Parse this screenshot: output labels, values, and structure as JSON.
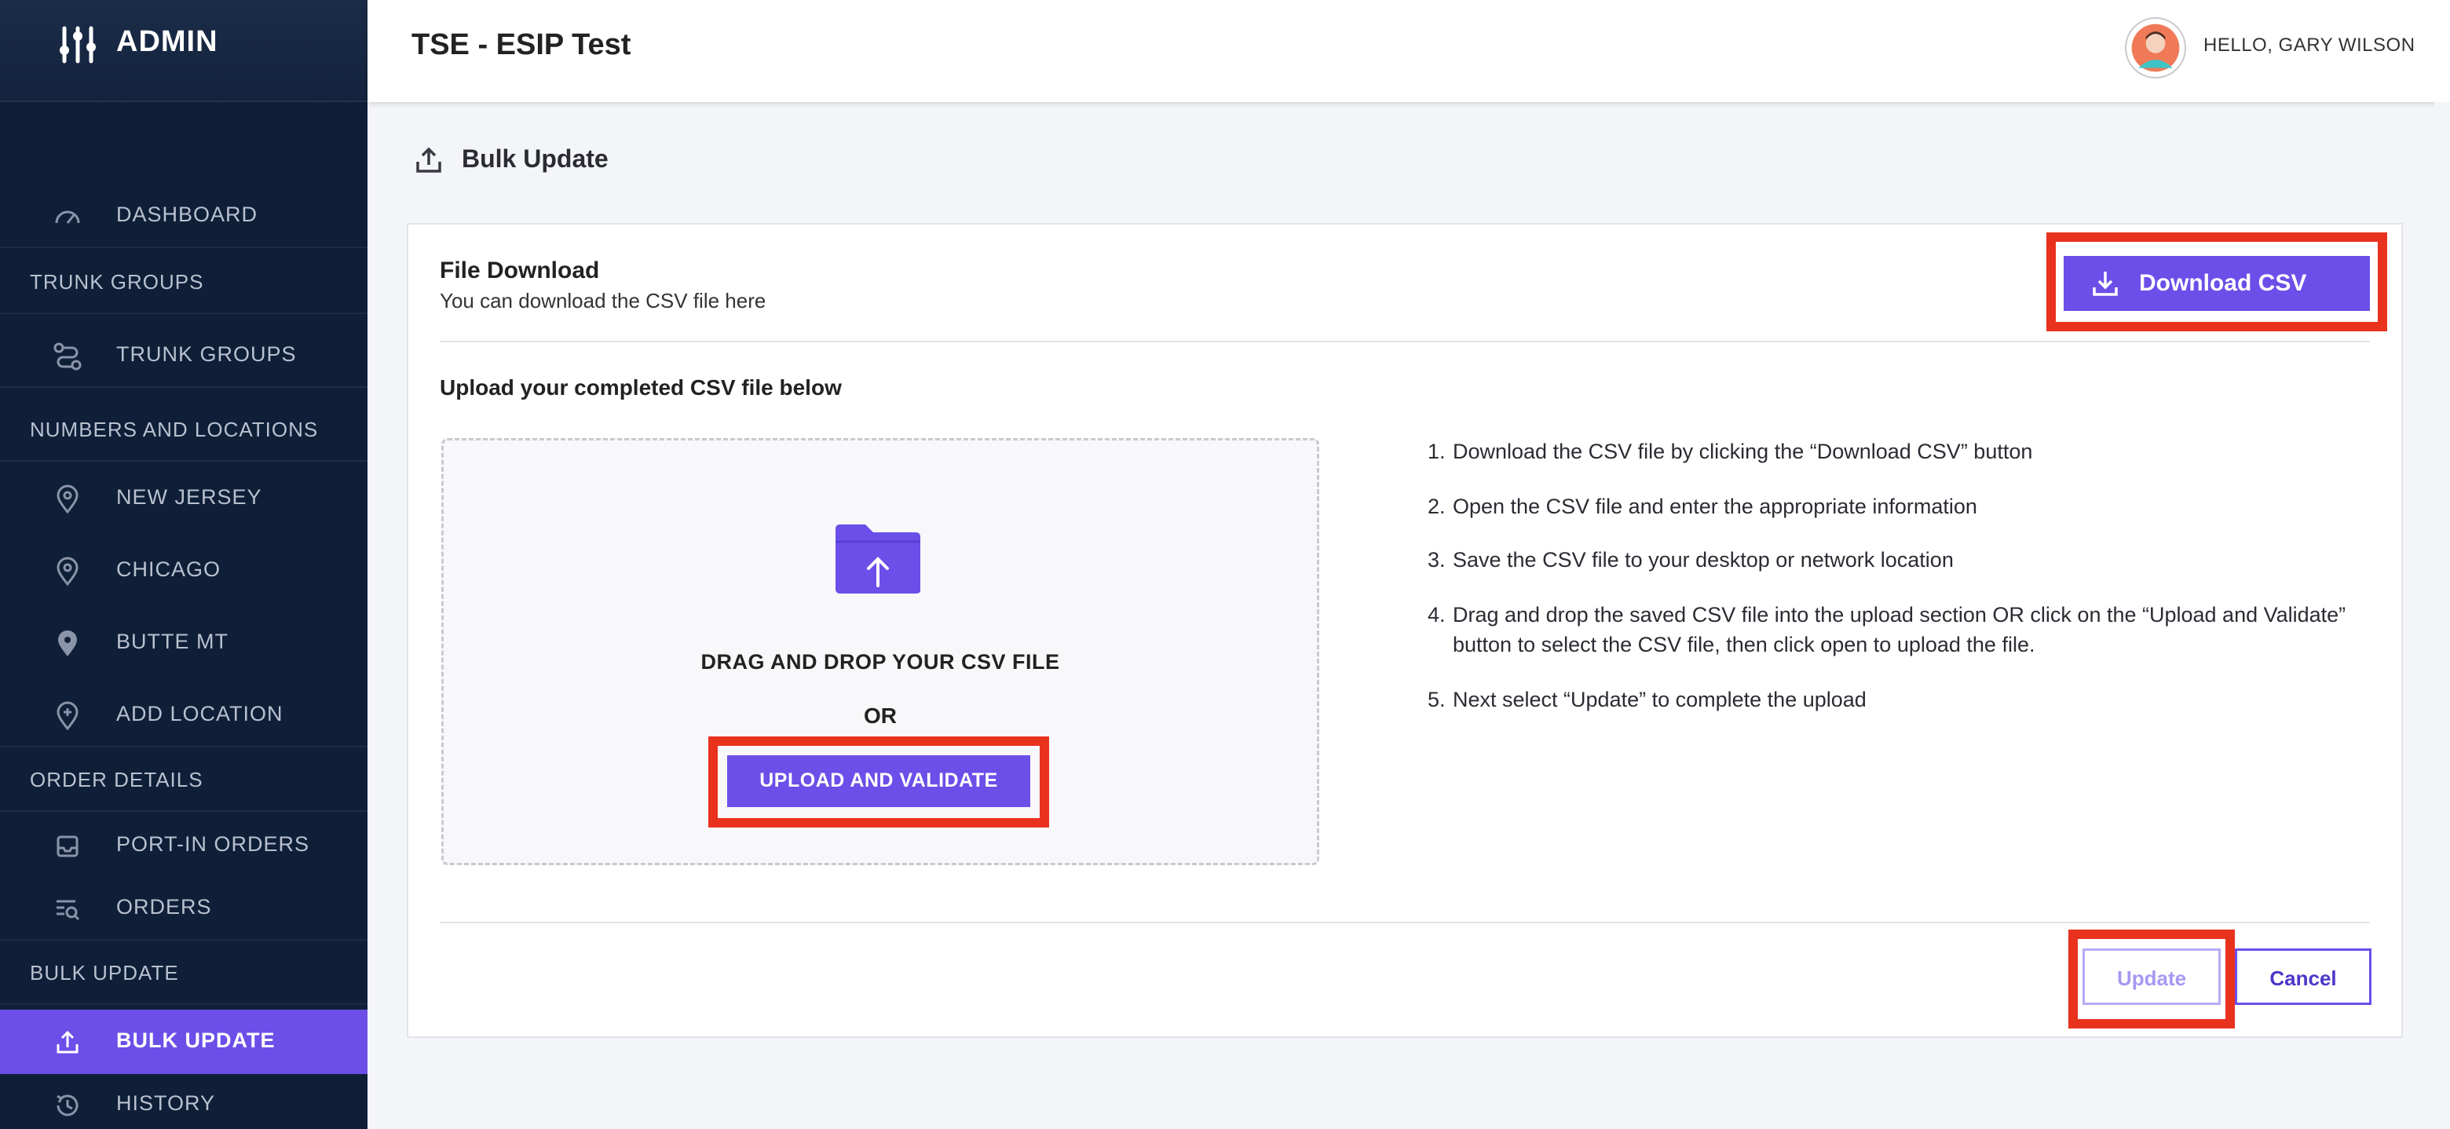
{
  "sidebar": {
    "brand": "ADMIN",
    "items": [
      {
        "label": "DASHBOARD",
        "icon": "gauge-icon"
      },
      {
        "label": "TRUNK GROUPS",
        "section": true
      },
      {
        "label": "TRUNK GROUPS",
        "icon": "route-icon"
      },
      {
        "label": "NUMBERS AND LOCATIONS",
        "section": true
      },
      {
        "label": "NEW JERSEY",
        "icon": "location-pin-outline-icon"
      },
      {
        "label": "CHICAGO",
        "icon": "location-pin-outline-icon"
      },
      {
        "label": "BUTTE MT",
        "icon": "location-pin-filled-icon"
      },
      {
        "label": "ADD LOCATION",
        "icon": "location-add-icon"
      },
      {
        "label": "ORDER DETAILS",
        "section": true
      },
      {
        "label": "PORT-IN ORDERS",
        "icon": "inbox-icon"
      },
      {
        "label": "ORDERS",
        "icon": "list-search-icon"
      },
      {
        "label": "BULK UPDATE",
        "section": true
      },
      {
        "label": "BULK UPDATE",
        "icon": "upload-icon",
        "active": true
      },
      {
        "label": "HISTORY",
        "icon": "history-icon"
      }
    ]
  },
  "header": {
    "title": "TSE - ESIP Test",
    "greeting": "HELLO, GARY WILSON"
  },
  "page": {
    "title": "Bulk Update",
    "file_download": {
      "title": "File Download",
      "subtitle": "You can download the CSV file here",
      "button": "Download CSV"
    },
    "upload": {
      "heading": "Upload your completed CSV file below",
      "drag_text": "DRAG AND DROP YOUR CSV FILE",
      "or_text": "OR",
      "button": "UPLOAD AND VALIDATE"
    },
    "instructions": [
      {
        "num": "1.",
        "text": "Download the CSV file by clicking the “Download CSV” button"
      },
      {
        "num": "2.",
        "text": "Open the CSV file and enter the appropriate information"
      },
      {
        "num": "3.",
        "text": "Save the CSV file to your desktop or network location"
      },
      {
        "num": "4.",
        "text": "Drag and drop the saved CSV file into the upload section OR click on the “Upload and Validate” button to select the CSV file, then click open to upload the file."
      },
      {
        "num": "5.",
        "text": "Next select “Update” to complete the upload"
      }
    ],
    "actions": {
      "update": "Update",
      "cancel": "Cancel"
    }
  },
  "colors": {
    "sidebar_bg": "#0f1f38",
    "accent": "#6b4fe8",
    "highlight": "#e8321e"
  }
}
